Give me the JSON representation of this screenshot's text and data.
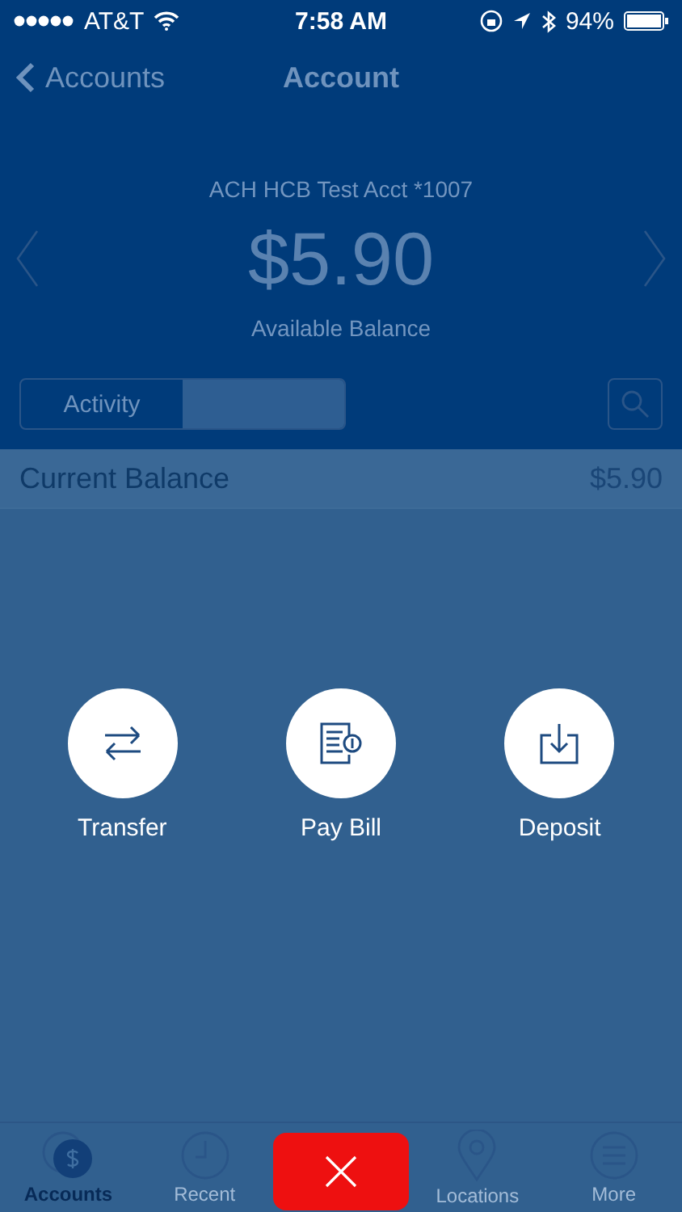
{
  "status_bar": {
    "carrier": "AT&T",
    "time": "7:58 AM",
    "battery": "94%"
  },
  "nav": {
    "back": "Accounts",
    "title": "Account"
  },
  "account": {
    "name": "ACH HCB Test Acct *1007",
    "balance": "$5.90",
    "balance_label": "Available Balance"
  },
  "segments": [
    {
      "label": "Activity",
      "selected": false
    },
    {
      "selected": true
    }
  ],
  "current_balance": {
    "label": "Current Balance",
    "value": "$5.90"
  },
  "actions": [
    {
      "kind": "transfer",
      "label": "Transfer"
    },
    {
      "kind": "paybill",
      "label": "Pay Bill"
    },
    {
      "kind": "deposit",
      "label": "Deposit"
    }
  ],
  "tab_bar": [
    {
      "kind": "accounts",
      "label": "Accounts",
      "selected": true
    },
    {
      "kind": "recent",
      "label": "Recent",
      "selected": false
    },
    {
      "kind": "close"
    },
    {
      "kind": "locations",
      "label": "Locations",
      "selected": false
    },
    {
      "kind": "more",
      "label": "More",
      "selected": false
    }
  ]
}
